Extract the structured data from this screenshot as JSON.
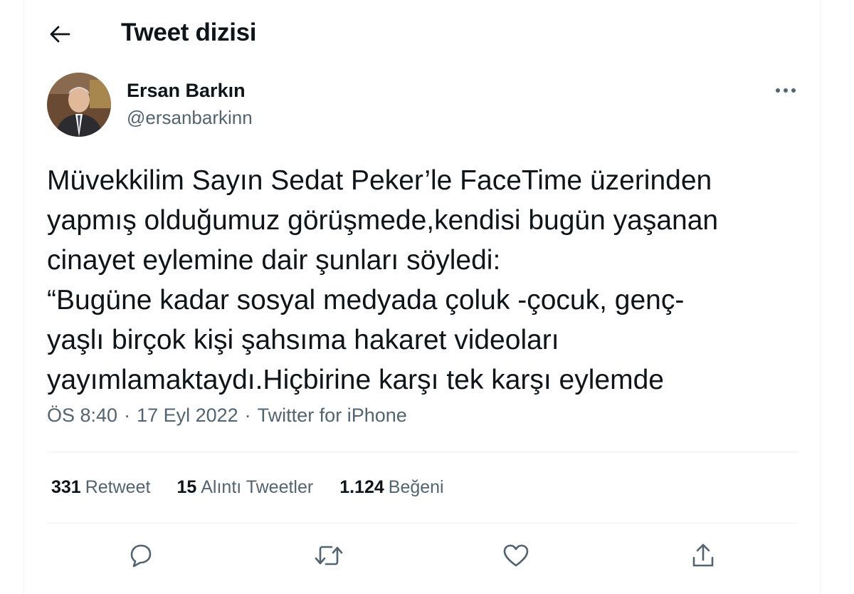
{
  "header": {
    "title": "Tweet dizisi"
  },
  "author": {
    "display_name": "Ersan Barkın",
    "handle": "@ersanbarkinn"
  },
  "tweet": {
    "text": "Müvekkilim Sayın Sedat Peker’le FaceTime üzerinden\nyapmış olduğumuz görüşmede,kendisi bugün yaşanan\ncinayet eylemine dair şunları söyledi:\n“Bugüne kadar sosyal medyada çoluk -çocuk, genç-\nyaşlı birçok kişi şahsıma hakaret videoları\nyayımlamaktaydı.Hiçbirine karşı tek karşı eylemde",
    "time": "ÖS 8:40",
    "date": "17 Eyl 2022",
    "source": "Twitter for iPhone",
    "separator": "·"
  },
  "stats": {
    "retweets": {
      "count": "331",
      "label": "Retweet"
    },
    "quotes": {
      "count": "15",
      "label": "Alıntı Tweetler"
    },
    "likes": {
      "count": "1.124",
      "label": "Beğeni"
    }
  },
  "icons": {
    "back": "arrow-left-icon",
    "more": "more-horizontal-icon",
    "reply": "reply-icon",
    "retweet": "retweet-icon",
    "like": "heart-icon",
    "share": "share-icon"
  },
  "colors": {
    "text": "#0f1419",
    "secondary": "#536471",
    "divider": "#eff3f4"
  }
}
